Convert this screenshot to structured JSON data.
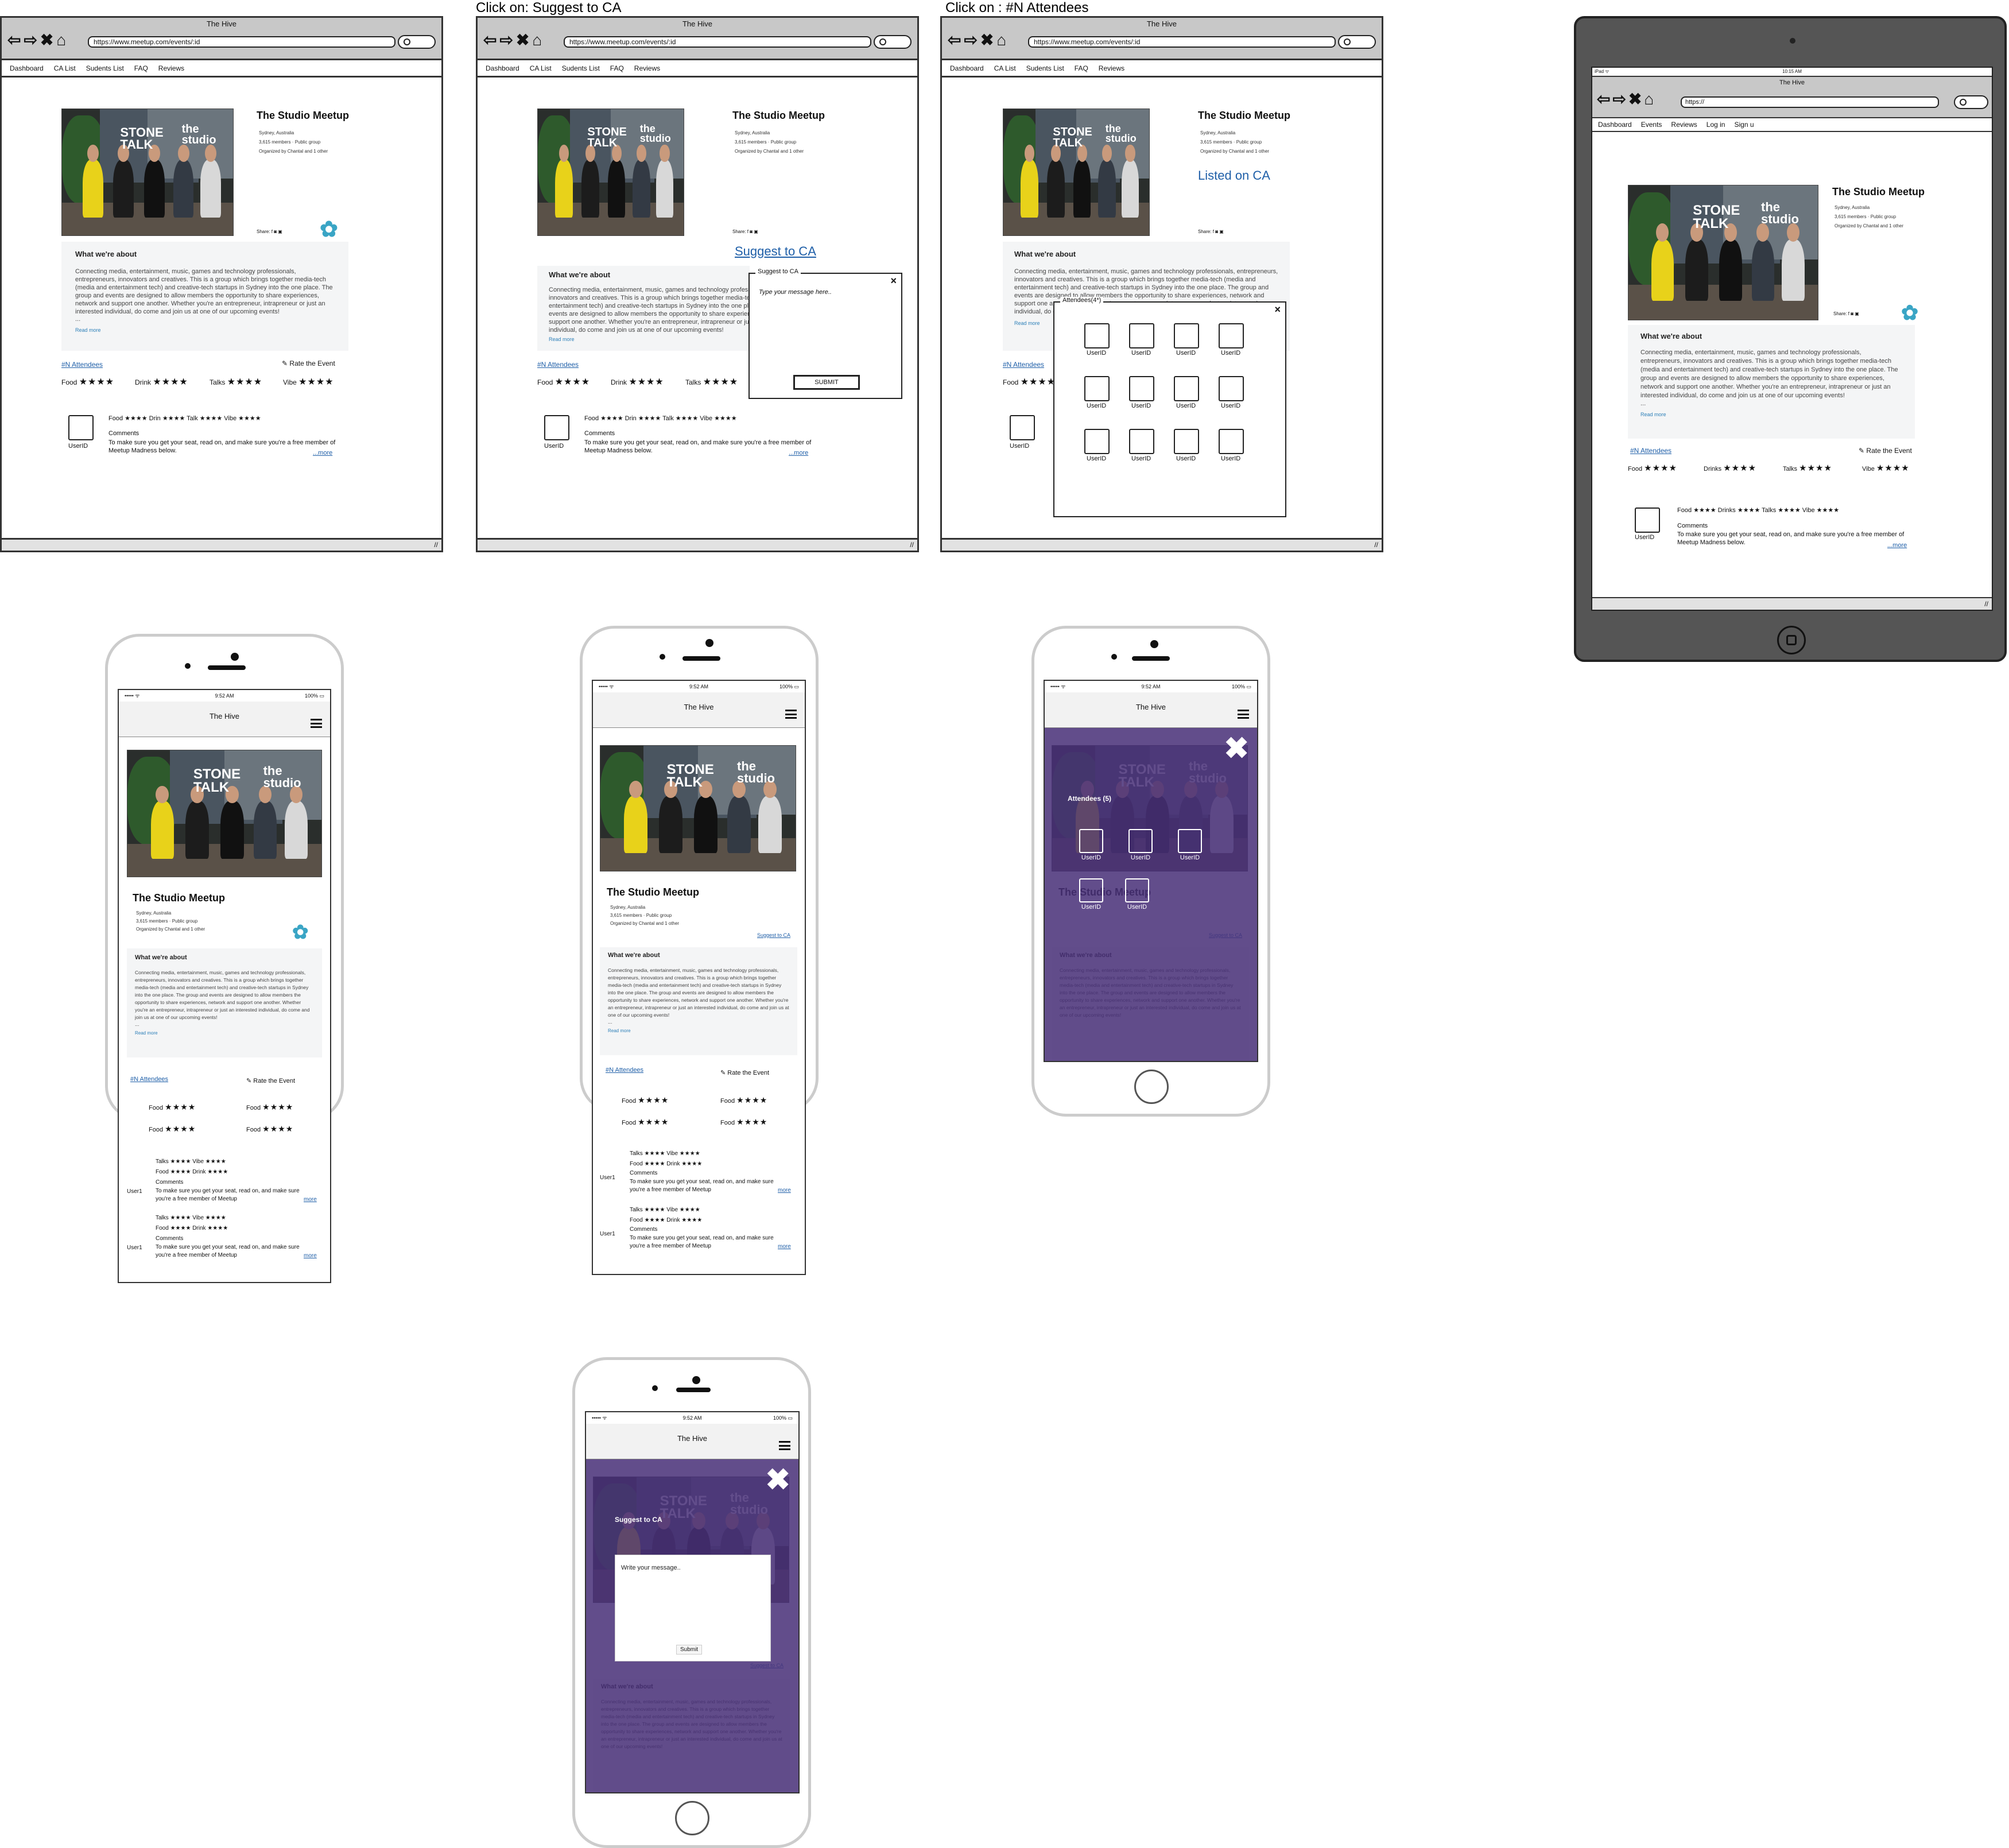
{
  "captions": {
    "suggest": "Click on: Suggest to CA",
    "attendees": "Click on : #N Attendees"
  },
  "browser": {
    "title": "The Hive",
    "url": "https://www.meetup.com/events/:id",
    "nav_glyphs": "⇦⇨✖⌂",
    "menu": [
      "Dashboard",
      "CA List",
      "Sudents List",
      "FAQ",
      "Reviews"
    ],
    "grip": "//"
  },
  "event": {
    "title": "The Studio Meetup",
    "location": "Sydney, Australia",
    "members": "3,615 members · Public group",
    "organizer": "Organized by Chantal and 1 other",
    "share": "Share: f ◙ ▣",
    "photo_sign_1": "STONE\nTALK",
    "photo_sign_2": "the\nstudio",
    "logo": "✿",
    "about_heading": "What we're about",
    "about_text": "Connecting media, entertainment, music, games and technology professionals, entrepreneurs, innovators and creatives. This is a group which brings together media-tech (media and entertainment tech) and creative-tech startups in Sydney into the one place. The group and events are designed to allow members the opportunity to share experiences, network and support one another. Whether you're an entrepreneur, intrapreneur or just an interested individual, do come and join us at one of our upcoming events!",
    "ellipsis": "...",
    "read_more": "Read more",
    "attendees_link": "#N Attendees",
    "rate_event": "Rate the Event",
    "rate_icon": "✎",
    "ratings": [
      {
        "label": "Food",
        "stars": "★★★★"
      },
      {
        "label": "Drink",
        "stars": "★★★★"
      },
      {
        "label": "Talks",
        "stars": "★★★★"
      },
      {
        "label": "Vibe",
        "stars": "★★★★"
      }
    ],
    "review": {
      "user": "UserID",
      "line": "Food ★★★★   Drin ★★★★   Talk ★★★★   Vibe ★★★★",
      "comments": "Comments",
      "text": "To make sure you get your seat, read on, and make sure you're a free member of Meetup Madness below.",
      "more": "...more"
    }
  },
  "suggest": {
    "link": "Suggest to CA",
    "dialog_title": "Suggest to CA",
    "placeholder": "Type your message here..",
    "submit": "SUBMIT",
    "close": "×"
  },
  "attendees_view": {
    "listed": "Listed on CA",
    "dialog_title": "Attendees(4*)",
    "close": "×",
    "user": "UserID"
  },
  "tablet": {
    "status_left": "iPad ᯤ",
    "status_time": "10:15 AM",
    "url": "https://",
    "menu": [
      "Dashboard",
      "Events",
      "Reviews",
      "Log in",
      "Sign u"
    ],
    "rate_event": "Rate the Event",
    "ratings": [
      {
        "label": "Food",
        "stars": "★★★★"
      },
      {
        "label": "Drinks",
        "stars": "★★★★"
      },
      {
        "label": "Talks",
        "stars": "★★★★"
      },
      {
        "label": "Vibe",
        "stars": "★★★★"
      }
    ],
    "review_line": "Food ★★★★   Drinks ★★★★   Talks ★★★★   Vibe ★★★★"
  },
  "phone": {
    "status_left": "••••• ᯤ",
    "time": "9:52 AM",
    "battery": "100% ▭",
    "app_title": "The Hive",
    "user": "User1",
    "rate_event": "Rate the Event",
    "rating_rows": [
      [
        {
          "label": "Food",
          "stars": "★★★★"
        },
        {
          "label": "Food",
          "stars": "★★★★"
        }
      ],
      [
        {
          "label": "Food",
          "stars": "★★★★"
        },
        {
          "label": "Food",
          "stars": "★★★★"
        }
      ]
    ],
    "review_l1": "Talks ★★★★   Vibe ★★★★",
    "review_l2": "Food ★★★★   Drink ★★★★",
    "comments": "Comments",
    "review_text": "To make sure you get your seat, read on, and make sure you're a free member of Meetup",
    "more": "more",
    "suggest_link": "Suggest to CA",
    "overlay_close": "✖",
    "attendees_title": "Attendees (5)",
    "overlay_user": "UserID",
    "suggest_title": "Suggest to CA",
    "suggest_placeholder": "Write your message..",
    "suggest_submit": "Submit"
  }
}
